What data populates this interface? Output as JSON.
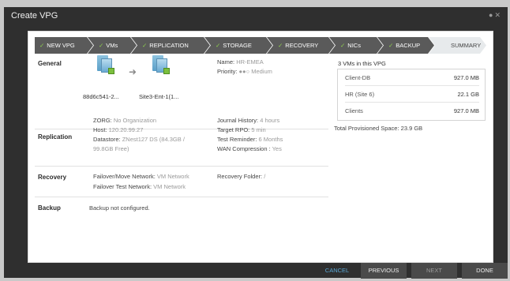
{
  "window": {
    "title": "Create VPG",
    "icons": [
      "info-icon",
      "close-icon"
    ]
  },
  "wizard": {
    "steps": [
      {
        "label": "NEW VPG",
        "done": true
      },
      {
        "label": "VMs",
        "done": true
      },
      {
        "label": "REPLICATION",
        "done": true
      },
      {
        "label": "STORAGE",
        "done": true
      },
      {
        "label": "RECOVERY",
        "done": true
      },
      {
        "label": "NICs",
        "done": true
      },
      {
        "label": "BACKUP",
        "done": true
      },
      {
        "label": "SUMMARY",
        "done": false
      }
    ]
  },
  "general": {
    "label": "General",
    "source_site": "88d6c541-2...",
    "target_site": "Site3-Ent-1(1...",
    "name_label": "Name:",
    "name_value": "HR-EMEA",
    "priority_label": "Priority:",
    "priority_value": "Medium",
    "priority_dots": "●●○"
  },
  "replication": {
    "label": "Replication",
    "zorg_label": "ZORG:",
    "zorg_value": "No Organization",
    "host_label": "Host:",
    "host_value": "120.20.99.27",
    "datastore_label": "Datastore:",
    "datastore_value_1": "ZNest127 DS (84.3GB /",
    "datastore_value_2": "99.8GB Free)",
    "journal_label": "Journal History:",
    "journal_value": "4 hours",
    "rpo_label": "Target RPO:",
    "rpo_value": "5 min",
    "reminder_label": "Test Reminder:",
    "reminder_value": "6 Months",
    "wan_label": "WAN Compression :",
    "wan_value": "Yes"
  },
  "recovery": {
    "label": "Recovery",
    "failover_label": "Failover/Move Network:",
    "failover_value": "VM Network",
    "test_label": "Failover Test Network:",
    "test_value": "VM Network",
    "folder_label": "Recovery Folder:",
    "folder_value": "/"
  },
  "backup": {
    "label": "Backup",
    "value": "Backup not configured."
  },
  "summary": {
    "heading": "3 VMs in this VPG",
    "vms": [
      {
        "name": "Client-DB",
        "size": "927.0 MB"
      },
      {
        "name": "HR (Site 6)",
        "size": "22.1 GB"
      },
      {
        "name": "Clients",
        "size": "927.0 MB"
      }
    ],
    "total_label": "Total Provisioned Space:",
    "total_value": "23.9 GB"
  },
  "footer": {
    "cancel": "CANCEL",
    "previous": "PREVIOUS",
    "next": "NEXT",
    "done": "DONE"
  }
}
